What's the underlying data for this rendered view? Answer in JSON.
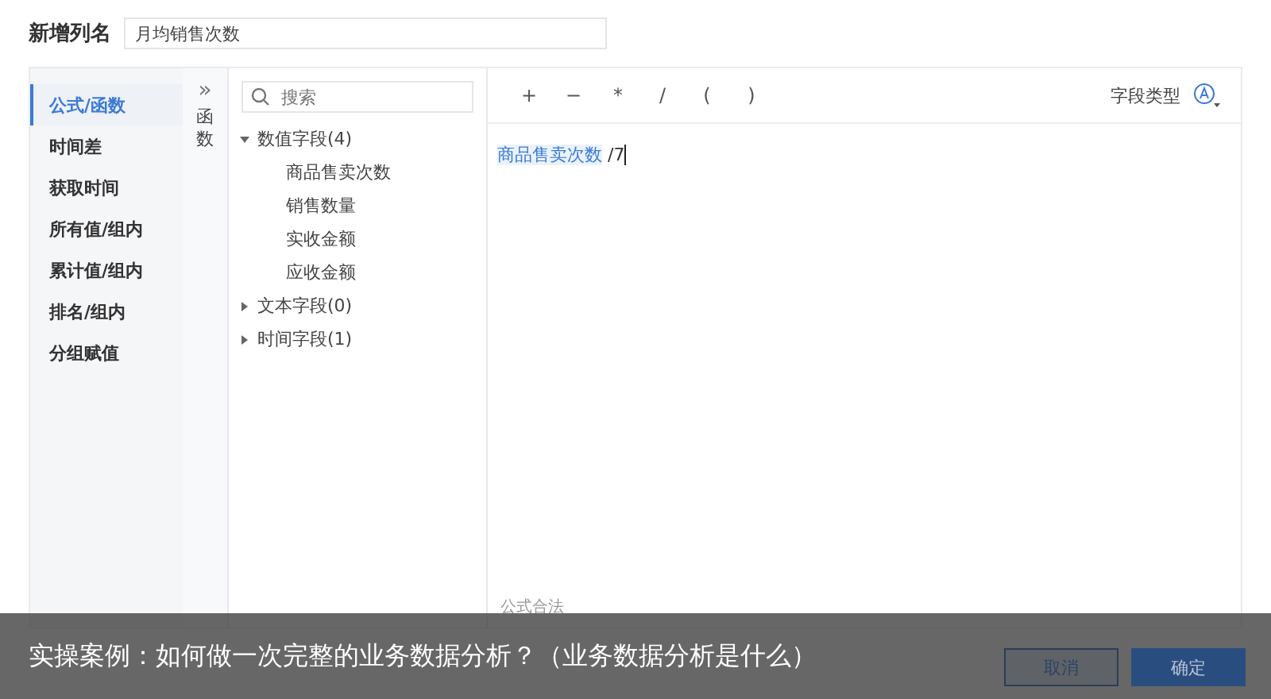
{
  "column_name": {
    "label": "新增列名",
    "value": "月均销售次数"
  },
  "categories": [
    {
      "label": "公式/函数",
      "selected": true
    },
    {
      "label": "时间差",
      "selected": false
    },
    {
      "label": "获取时间",
      "selected": false
    },
    {
      "label": "所有值/组内",
      "selected": false
    },
    {
      "label": "累计值/组内",
      "selected": false
    },
    {
      "label": "排名/组内",
      "selected": false
    },
    {
      "label": "分组赋值",
      "selected": false
    }
  ],
  "function_toggle": {
    "icon": "»",
    "label": "函数"
  },
  "search": {
    "placeholder": "搜索"
  },
  "tree": [
    {
      "label": "数值字段(4)",
      "expanded": true,
      "children": [
        {
          "label": "商品售卖次数"
        },
        {
          "label": "销售数量"
        },
        {
          "label": "实收金额"
        },
        {
          "label": "应收金额"
        }
      ]
    },
    {
      "label": "文本字段(0)",
      "expanded": false
    },
    {
      "label": "时间字段(1)",
      "expanded": false
    }
  ],
  "operators": [
    "+",
    "−",
    "*",
    "/",
    "(",
    ")"
  ],
  "field_type": {
    "label": "字段类型"
  },
  "formula": [
    {
      "kind": "field",
      "text": "商品售卖次数"
    },
    {
      "kind": "text",
      "text": " /7"
    }
  ],
  "status": "公式合法",
  "buttons": [
    {
      "label": "取消",
      "kind": "secondary"
    },
    {
      "label": "确定",
      "kind": "primary"
    }
  ],
  "caption": "实操案例：如何做一次完整的业务数据分析？（业务数据分析是什么）"
}
